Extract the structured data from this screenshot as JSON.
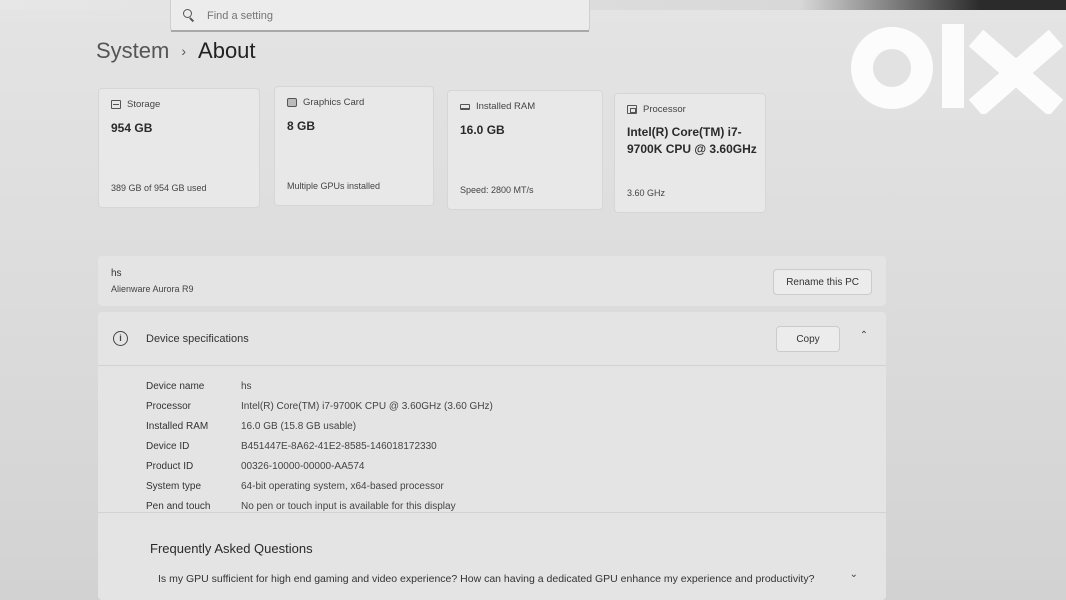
{
  "search": {
    "placeholder": "Find a setting",
    "icon": "search-icon"
  },
  "breadcrumb": {
    "parent": "System",
    "separator": "›",
    "current": "About"
  },
  "cards": [
    {
      "icon": "storage-icon",
      "label": "Storage",
      "value": "954 GB",
      "sub": "389 GB of 954 GB used"
    },
    {
      "icon": "graphics-card-icon",
      "label": "Graphics Card",
      "value": "8 GB",
      "sub": "Multiple GPUs installed"
    },
    {
      "icon": "ram-icon",
      "label": "Installed RAM",
      "value": "16.0 GB",
      "sub": "Speed: 2800 MT/s"
    },
    {
      "icon": "processor-icon",
      "label": "Processor",
      "value": "Intel(R) Core(TM) i7-9700K CPU @ 3.60GHz",
      "sub": "3.60 GHz"
    }
  ],
  "pc": {
    "name": "hs",
    "model": "Alienware Aurora R9",
    "rename_label": "Rename this PC"
  },
  "device_specs": {
    "title": "Device specifications",
    "copy_label": "Copy",
    "rows": [
      {
        "key": "Device name",
        "value": "hs"
      },
      {
        "key": "Processor",
        "value": "Intel(R) Core(TM) i7-9700K CPU @ 3.60GHz (3.60 GHz)"
      },
      {
        "key": "Installed RAM",
        "value": "16.0 GB (15.8 GB usable)"
      },
      {
        "key": "Device ID",
        "value": "B451447E-8A62-41E2-8585-146018172330"
      },
      {
        "key": "Product ID",
        "value": "00326-10000-00000-AA574"
      },
      {
        "key": "System type",
        "value": "64-bit operating system, x64-based processor"
      },
      {
        "key": "Pen and touch",
        "value": "No pen or touch input is available for this display"
      }
    ]
  },
  "faq": {
    "title": "Frequently Asked Questions",
    "question": "Is my GPU sufficient for high end gaming and video experience? How can having a dedicated GPU enhance my experience and productivity?"
  },
  "watermark": {
    "text": "olx",
    "color": "#ffffff"
  }
}
